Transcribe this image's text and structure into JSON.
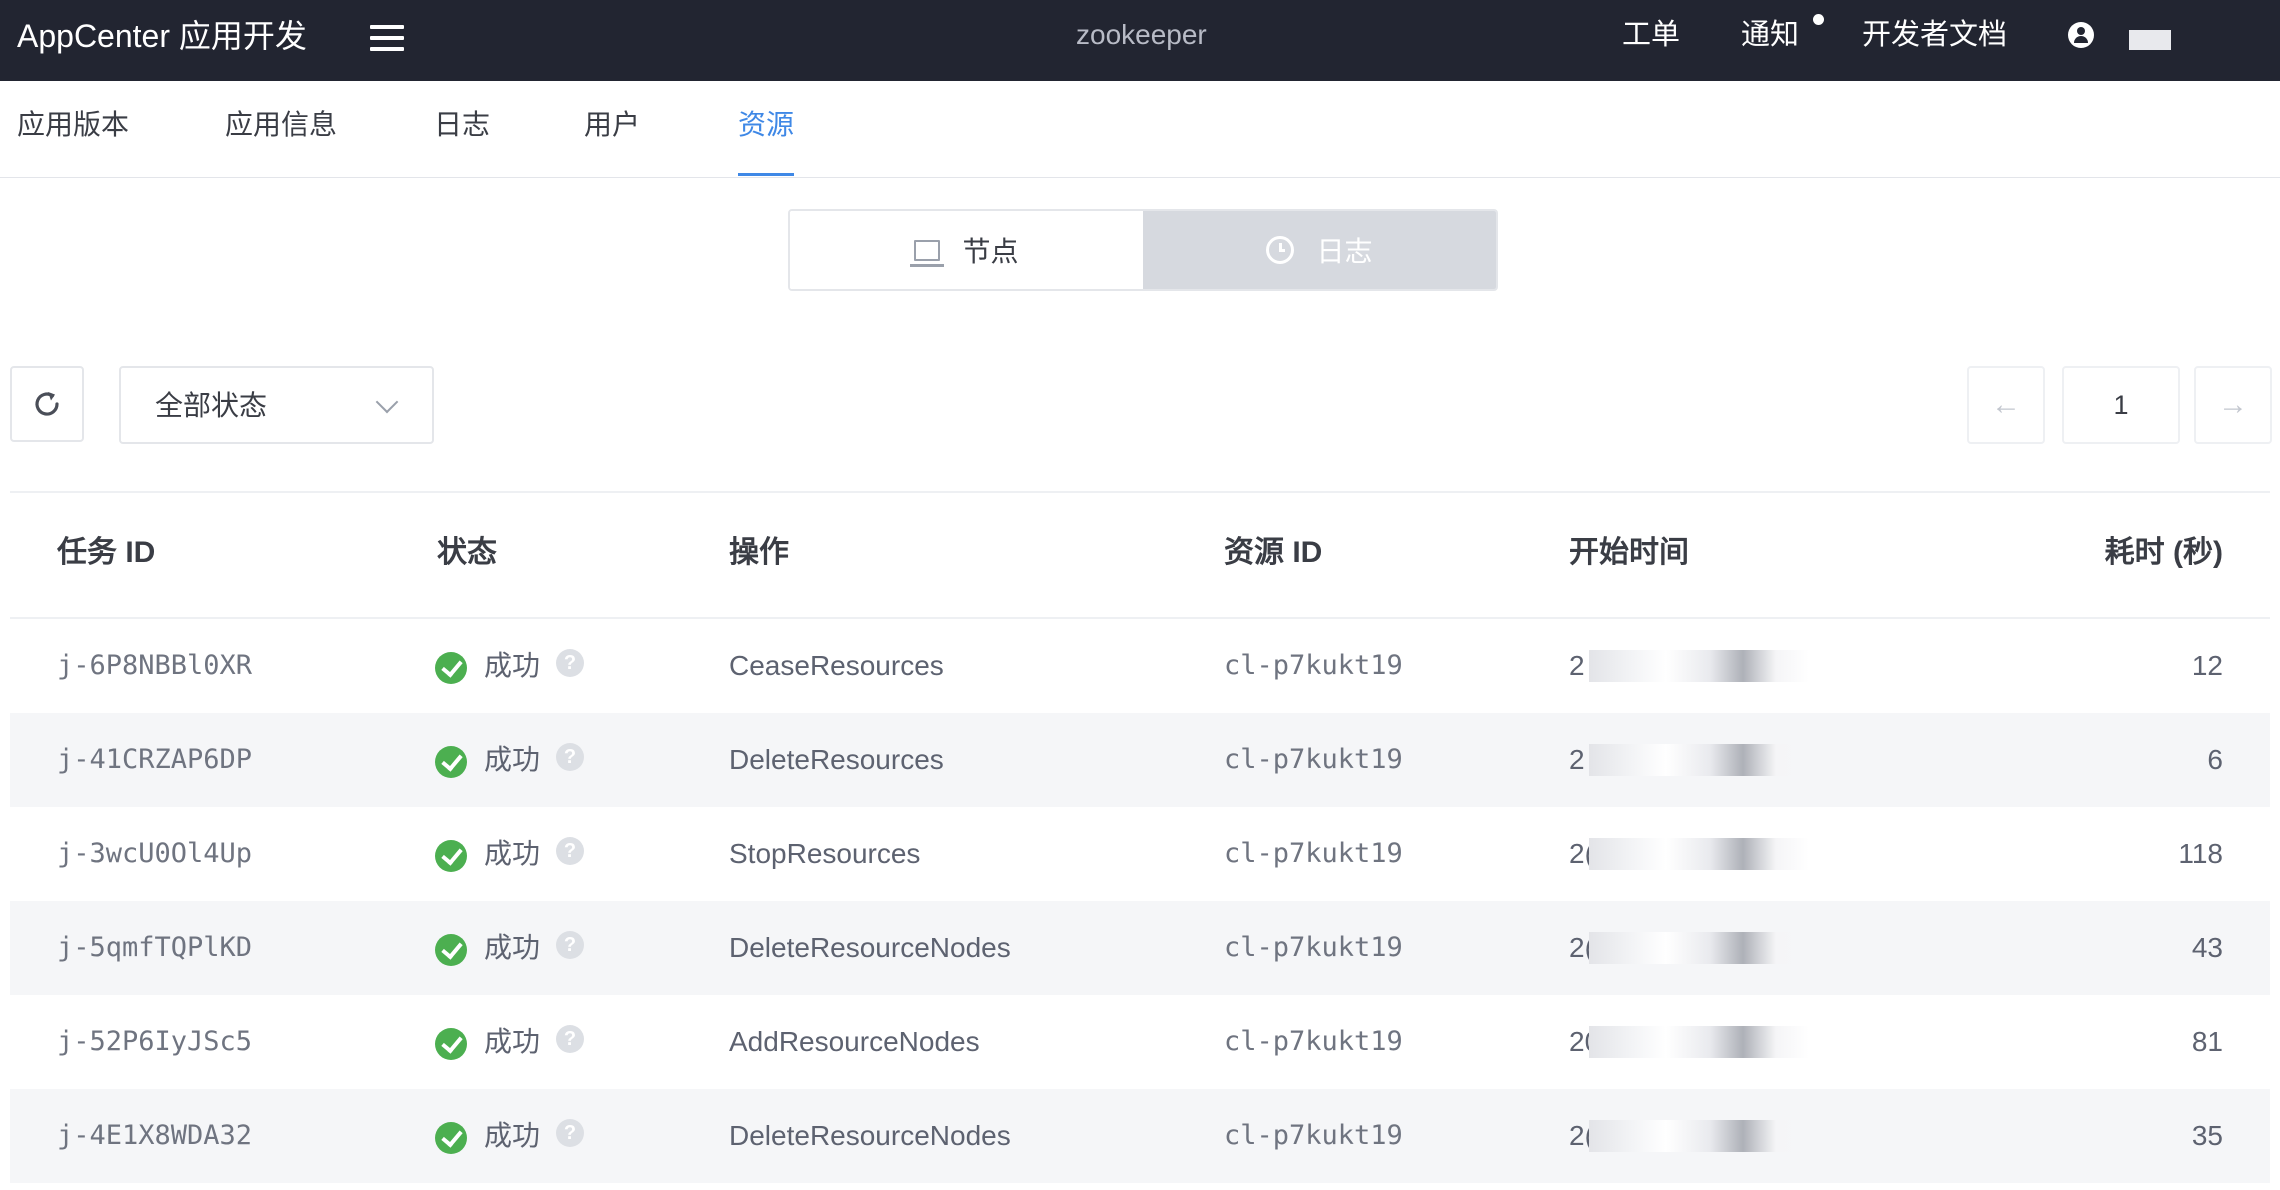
{
  "topbar": {
    "brand": "AppCenter 应用开发",
    "app_name": "zookeeper",
    "links": {
      "tickets": "工单",
      "notifications": "通知",
      "docs": "开发者文档"
    }
  },
  "tabs": [
    "应用版本",
    "应用信息",
    "日志",
    "用户",
    "资源"
  ],
  "active_tab": "资源",
  "segment": {
    "nodes": "节点",
    "logs": "日志",
    "active": "日志"
  },
  "toolbar": {
    "status_filter": "全部状态",
    "page": "1"
  },
  "table": {
    "headers": {
      "job_id": "任务 ID",
      "status": "状态",
      "action": "操作",
      "resource_id": "资源 ID",
      "start_time": "开始时间",
      "duration": "耗时 (秒)"
    },
    "rows": [
      {
        "job_id": "j-6P8NBBl0XR",
        "status": "成功",
        "action": "CeaseResources",
        "resource_id": "cl-p7kukt19",
        "start_time": "2      2:42",
        "duration": "12"
      },
      {
        "job_id": "j-41CRZAP6DP",
        "status": "成功",
        "action": "DeleteResources",
        "resource_id": "cl-p7kukt19",
        "start_time": "2        42",
        "duration": "6"
      },
      {
        "job_id": "j-3wcU0Ol4Up",
        "status": "成功",
        "action": "StopResources",
        "resource_id": "cl-p7kukt19",
        "start_time": "2(      ):40",
        "duration": "118"
      },
      {
        "job_id": "j-5qmfTQPlKD",
        "status": "成功",
        "action": "DeleteResourceNodes",
        "resource_id": "cl-p7kukt19",
        "start_time": "2(      ):57",
        "duration": "43"
      },
      {
        "job_id": "j-52P6IyJSc5",
        "status": "成功",
        "action": "AddResourceNodes",
        "resource_id": "cl-p7kukt19",
        "start_time": "20      9:46",
        "duration": "81"
      },
      {
        "job_id": "j-4E1X8WDA32",
        "status": "成功",
        "action": "DeleteResourceNodes",
        "resource_id": "cl-p7kukt19",
        "start_time": "2(     09:45",
        "duration": "35"
      }
    ]
  },
  "colors": {
    "topbar_bg": "#222531",
    "accent": "#3f88e6",
    "success": "#4caf50"
  }
}
